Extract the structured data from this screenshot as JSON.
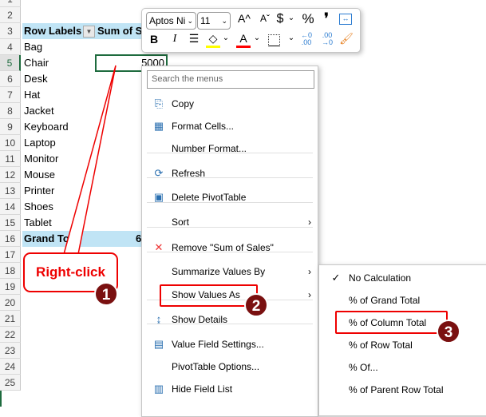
{
  "sheet": {
    "row_numbers": [
      "1",
      "2",
      "3",
      "4",
      "5",
      "6",
      "7",
      "8",
      "9",
      "10",
      "11",
      "12",
      "13",
      "14",
      "15",
      "16",
      "17",
      "18",
      "19",
      "20",
      "21",
      "22",
      "23",
      "24",
      "25"
    ],
    "header": {
      "row_labels": "Row Labels",
      "sum_col": "Sum of S"
    },
    "rows": [
      "Bag",
      "Chair",
      "Desk",
      "Hat",
      "Jacket",
      "Keyboard",
      "Laptop",
      "Monitor",
      "Mouse",
      "Printer",
      "Shoes",
      "Tablet"
    ],
    "selected_value": "5000",
    "grand_total_label": "Grand Tot",
    "grand_total_value": "6"
  },
  "toolbar": {
    "font_name": "Aptos Ni",
    "font_size": "11",
    "increase_font": "A^",
    "decrease_font": "Aˇ",
    "currency": "$",
    "percent": "%",
    "comma": "❜",
    "bold": "B",
    "italic": "I",
    "font_color": "A",
    "fill_color": "#ffff00",
    "font_color_value": "#ff0000"
  },
  "context_menu": {
    "search_placeholder": "Search the menus",
    "items": [
      {
        "label": "Copy",
        "icon": "copy-icon"
      },
      {
        "label": "Format Cells...",
        "icon": "format-cells-icon"
      },
      {
        "label": "Number Format..."
      },
      {
        "label": "Refresh",
        "icon": "refresh-icon"
      },
      {
        "label": "Delete PivotTable",
        "icon": "delete-pivot-icon"
      },
      {
        "label": "Sort"
      },
      {
        "label": "Remove \"Sum of Sales\"",
        "icon": "remove-icon"
      },
      {
        "label": "Summarize Values By"
      },
      {
        "label": "Show Values As"
      },
      {
        "label": "Show Details",
        "icon": "show-details-icon"
      },
      {
        "label": "Value Field Settings...",
        "icon": "value-field-settings-icon"
      },
      {
        "label": "PivotTable Options..."
      },
      {
        "label": "Hide Field List",
        "icon": "field-list-icon"
      }
    ]
  },
  "submenu": {
    "items": [
      "No Calculation",
      "% of Grand Total",
      "% of Column Total",
      "% of Row Total",
      "% Of...",
      "% of Parent Row Total"
    ],
    "checked": "No Calculation"
  },
  "annotations": {
    "callout": "Right-click",
    "step1": "1",
    "step2": "2",
    "step3": "3"
  }
}
